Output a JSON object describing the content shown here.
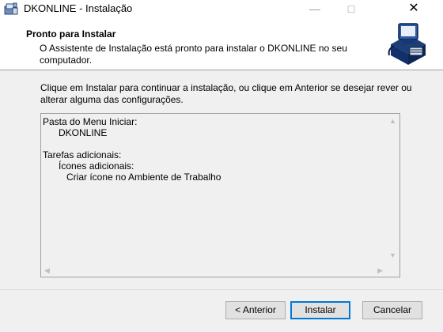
{
  "window": {
    "title": "DKONLINE - Instalação",
    "icons": {
      "app": "installer-icon",
      "minimize": "minimize-icon",
      "maximize": "maximize-icon",
      "close": "close-icon"
    }
  },
  "header": {
    "title": "Pronto para Instalar",
    "subtitle": "O Assistente de Instalação está pronto para instalar o DKONLINE no seu computador.",
    "image_icon": "computer-box-icon"
  },
  "body": {
    "intro": "Clique em Instalar para continuar a instalação, ou clique em Anterior se desejar rever ou alterar alguma das configurações.",
    "memo": {
      "start_menu_label": "Pasta do Menu Iniciar:",
      "start_menu_value": "DKONLINE",
      "tasks_label": "Tarefas adicionais:",
      "icons_label": "Ícones adicionais:",
      "icons_value": "Criar ícone no Ambiente de Trabalho"
    }
  },
  "buttons": {
    "back": "< Anterior",
    "install": "Instalar",
    "cancel": "Cancelar"
  },
  "colors": {
    "focus": "#0078d7",
    "panel": "#f0f0f0",
    "header_bg": "#ffffff"
  }
}
